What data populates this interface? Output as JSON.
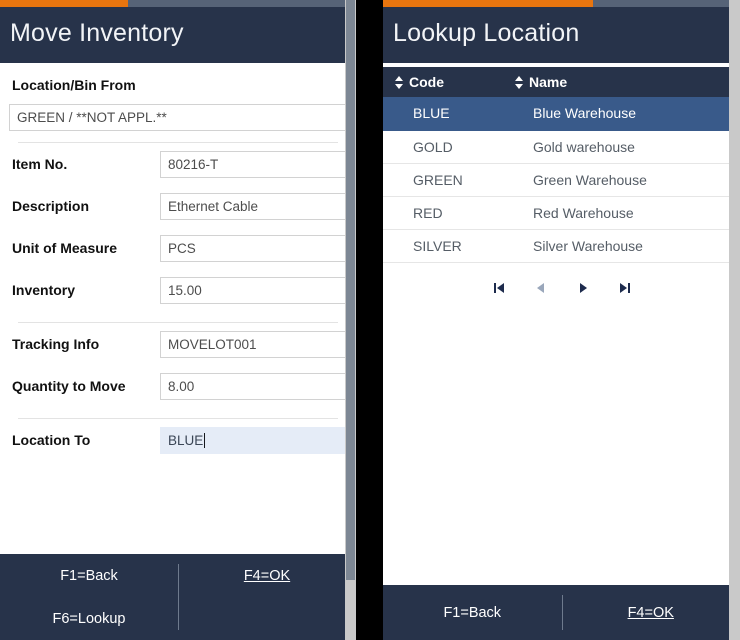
{
  "colors": {
    "header_navy": "#27334a",
    "accent_orange": "#e8750f",
    "progress_track": "#566377",
    "selected_row_blue": "#395a8a",
    "focused_field_blue": "#e5ecf7"
  },
  "left_panel": {
    "title": "Move Inventory",
    "section_label": "Location/Bin From",
    "location_bin_from": {
      "value": "GREEN /  **NOT APPL.**",
      "placeholder": "Location/Bin From"
    },
    "fields": [
      {
        "label": "Item No.",
        "value": "80216-T",
        "placeholder": "Item No.",
        "focused": false
      },
      {
        "label": "Description",
        "value": "Ethernet Cable",
        "placeholder": "Description",
        "focused": false
      },
      {
        "label": "Unit of Measure",
        "value": "PCS",
        "placeholder": "Unit of Measure",
        "focused": false
      },
      {
        "label": "Inventory",
        "value": "15.00",
        "placeholder": "Inventory",
        "focused": false
      },
      {
        "label": "Tracking Info",
        "value": "MOVELOT001",
        "placeholder": "Tracking Info",
        "focused": false
      },
      {
        "label": "Quantity to Move",
        "value": "8.00",
        "placeholder": "Quantity to Move",
        "focused": false
      },
      {
        "label": "Location To",
        "value": "BLUE",
        "placeholder": "Location To",
        "focused": true
      }
    ],
    "footer": {
      "back": "F1=Back",
      "ok": "F4=OK",
      "lookup": "F6=Lookup"
    }
  },
  "right_panel": {
    "title": "Lookup Location",
    "table": {
      "columns": [
        {
          "label": "Code",
          "sort_icon": "sort-updown-icon"
        },
        {
          "label": "Name",
          "sort_icon": "sort-updown-icon"
        }
      ],
      "rows": [
        {
          "code": "BLUE",
          "name": "Blue Warehouse",
          "selected": true
        },
        {
          "code": "GOLD",
          "name": "Gold warehouse",
          "selected": false
        },
        {
          "code": "GREEN",
          "name": "Green Warehouse",
          "selected": false
        },
        {
          "code": "RED",
          "name": "Red Warehouse",
          "selected": false
        },
        {
          "code": "SILVER",
          "name": "Silver Warehouse",
          "selected": false
        }
      ]
    },
    "pagination": [
      {
        "name": "first-page-button",
        "glyph": "first",
        "disabled": false
      },
      {
        "name": "previous-page-button",
        "glyph": "prev",
        "disabled": true
      },
      {
        "name": "next-page-button",
        "glyph": "next",
        "disabled": false
      },
      {
        "name": "last-page-button",
        "glyph": "last",
        "disabled": false
      }
    ],
    "footer": {
      "back": "F1=Back",
      "ok": "F4=OK"
    }
  }
}
